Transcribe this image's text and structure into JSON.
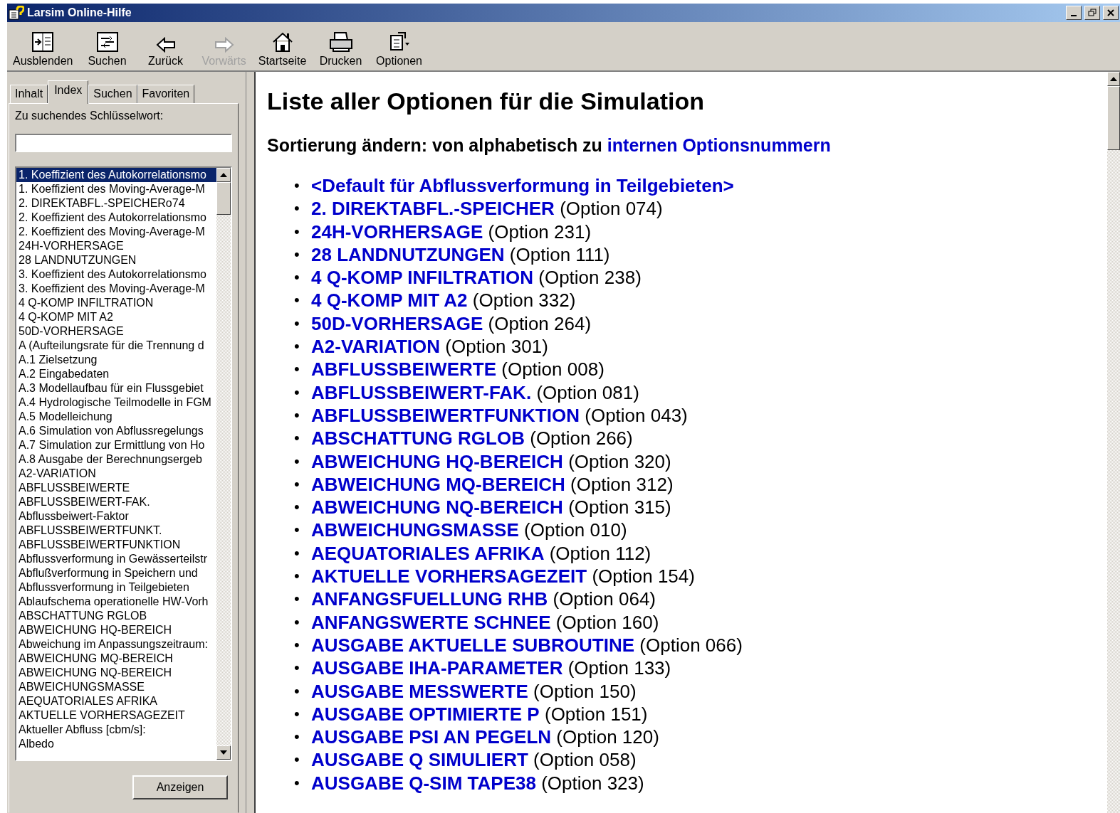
{
  "window": {
    "title": "Larsim Online-Hilfe"
  },
  "toolbar": [
    {
      "label": "Ausblenden",
      "disabled": false
    },
    {
      "label": "Suchen",
      "disabled": false
    },
    {
      "label": "Zurück",
      "disabled": false
    },
    {
      "label": "Vorwärts",
      "disabled": true
    },
    {
      "label": "Startseite",
      "disabled": false
    },
    {
      "label": "Drucken",
      "disabled": false
    },
    {
      "label": "Optionen",
      "disabled": false
    }
  ],
  "tabs": [
    {
      "label": "Inhalt",
      "selected": false
    },
    {
      "label": "Index",
      "selected": true
    },
    {
      "label": "Suchen",
      "selected": false
    },
    {
      "label": "Favoriten",
      "selected": false
    }
  ],
  "keyword": {
    "label": "Zu suchendes Schlüsselwort:"
  },
  "index_items": [
    {
      "label": "1. Koeffizient des Autokorrelationsmo",
      "selected": true
    },
    {
      "label": "1. Koeffizient des Moving-Average-M",
      "selected": false
    },
    {
      "label": "2. DIREKTABFL.-SPEICHERo74",
      "selected": false
    },
    {
      "label": "2. Koeffizient des Autokorrelationsmo",
      "selected": false
    },
    {
      "label": "2. Koeffizient des Moving-Average-M",
      "selected": false
    },
    {
      "label": "24H-VORHERSAGE",
      "selected": false
    },
    {
      "label": "28 LANDNUTZUNGEN",
      "selected": false
    },
    {
      "label": "3. Koeffizient des Autokorrelationsmo",
      "selected": false
    },
    {
      "label": "3. Koeffizient des Moving-Average-M",
      "selected": false
    },
    {
      "label": "4 Q-KOMP INFILTRATION",
      "selected": false
    },
    {
      "label": "4 Q-KOMP MIT A2",
      "selected": false
    },
    {
      "label": "50D-VORHERSAGE",
      "selected": false
    },
    {
      "label": "A (Aufteilungsrate für die Trennung d",
      "selected": false
    },
    {
      "label": "A.1 Zielsetzung",
      "selected": false
    },
    {
      "label": "A.2 Eingabedaten",
      "selected": false
    },
    {
      "label": "A.3 Modellaufbau für ein Flussgebiet",
      "selected": false
    },
    {
      "label": "A.4 Hydrologische Teilmodelle in FGM",
      "selected": false
    },
    {
      "label": "A.5 Modelleichung",
      "selected": false
    },
    {
      "label": "A.6 Simulation von Abflussregelungs",
      "selected": false
    },
    {
      "label": "A.7 Simulation zur Ermittlung von Ho",
      "selected": false
    },
    {
      "label": "A.8 Ausgabe der Berechnungsergeb",
      "selected": false
    },
    {
      "label": "A2-VARIATION",
      "selected": false
    },
    {
      "label": "ABFLUSSBEIWERTE",
      "selected": false
    },
    {
      "label": "ABFLUSSBEIWERT-FAK.",
      "selected": false
    },
    {
      "label": "Abflussbeiwert-Faktor",
      "selected": false
    },
    {
      "label": "ABFLUSSBEIWERTFUNKT.",
      "selected": false
    },
    {
      "label": "ABFLUSSBEIWERTFUNKTION",
      "selected": false
    },
    {
      "label": "Abflussverformung in Gewässerteilstr",
      "selected": false
    },
    {
      "label": "Abflußverformung in Speichern und",
      "selected": false
    },
    {
      "label": "Abflussverformung in Teilgebieten",
      "selected": false
    },
    {
      "label": "Ablaufschema operationelle HW-Vorh",
      "selected": false
    },
    {
      "label": "ABSCHATTUNG RGLOB",
      "selected": false
    },
    {
      "label": "ABWEICHUNG HQ-BEREICH",
      "selected": false
    },
    {
      "label": "Abweichung im Anpassungszeitraum:",
      "selected": false
    },
    {
      "label": "ABWEICHUNG MQ-BEREICH",
      "selected": false
    },
    {
      "label": "ABWEICHUNG NQ-BEREICH",
      "selected": false
    },
    {
      "label": "ABWEICHUNGSMASSE",
      "selected": false
    },
    {
      "label": "AEQUATORIALES AFRIKA",
      "selected": false
    },
    {
      "label": "AKTUELLE VORHERSAGEZEIT",
      "selected": false
    },
    {
      "label": "Aktueller Abfluss [cbm/s]:",
      "selected": false
    },
    {
      "label": "Albedo",
      "selected": false
    }
  ],
  "show_button": "Anzeigen",
  "content": {
    "heading": "Liste aller Optionen für die Simulation",
    "sort_text": "Sortierung ändern: von alphabetisch zu",
    "sort_link": "internen Optionsnummern",
    "options": [
      {
        "bullet": "•",
        "name": "<Default für Abflussverformung in Teilgebieten>"
      },
      {
        "bullet": "•",
        "name": "2. DIREKTABFL.-SPEICHER",
        "number": "(Option 074)"
      },
      {
        "bullet": "•",
        "name": "24H-VORHERSAGE",
        "number": "(Option 231)"
      },
      {
        "bullet": "•",
        "name": "28 LANDNUTZUNGEN",
        "number": "(Option 111)"
      },
      {
        "bullet": "•",
        "name": "4 Q-KOMP INFILTRATION",
        "number": "(Option 238)"
      },
      {
        "bullet": "•",
        "name": "4 Q-KOMP MIT A2",
        "number": "(Option 332)"
      },
      {
        "bullet": "•",
        "name": "50D-VORHERSAGE",
        "number": "(Option 264)"
      },
      {
        "bullet": "•",
        "name": "A2-VARIATION",
        "number": "(Option 301)"
      },
      {
        "bullet": "•",
        "name": "ABFLUSSBEIWERTE",
        "number": "(Option 008)"
      },
      {
        "bullet": "•",
        "name": "ABFLUSSBEIWERT-FAK.",
        "number": "(Option 081)"
      },
      {
        "bullet": "•",
        "name": "ABFLUSSBEIWERTFUNKTION",
        "number": "(Option 043)"
      },
      {
        "bullet": "•",
        "name": "ABSCHATTUNG RGLOB",
        "number": "(Option 266)"
      },
      {
        "bullet": "•",
        "name": "ABWEICHUNG HQ-BEREICH",
        "number": "(Option 320)"
      },
      {
        "bullet": "•",
        "name": "ABWEICHUNG MQ-BEREICH",
        "number": "(Option 312)"
      },
      {
        "bullet": "•",
        "name": "ABWEICHUNG NQ-BEREICH",
        "number": "(Option 315)"
      },
      {
        "bullet": "•",
        "name": "ABWEICHUNGSMASSE",
        "number": "(Option 010)"
      },
      {
        "bullet": "•",
        "name": "AEQUATORIALES AFRIKA",
        "number": "(Option 112)"
      },
      {
        "bullet": "•",
        "name": "AKTUELLE VORHERSAGEZEIT",
        "number": "(Option 154)"
      },
      {
        "bullet": "•",
        "name": "ANFANGSFUELLUNG RHB",
        "number": "(Option 064)"
      },
      {
        "bullet": "•",
        "name": "ANFANGSWERTE SCHNEE",
        "number": "(Option 160)"
      },
      {
        "bullet": "•",
        "name": "AUSGABE AKTUELLE SUBROUTINE",
        "number": "(Option 066)"
      },
      {
        "bullet": "•",
        "name": "AUSGABE IHA-PARAMETER",
        "number": "(Option 133)"
      },
      {
        "bullet": "•",
        "name": "AUSGABE MESSWERTE",
        "number": "(Option 150)"
      },
      {
        "bullet": "•",
        "name": "AUSGABE OPTIMIERTE P",
        "number": "(Option 151)"
      },
      {
        "bullet": "•",
        "name": "AUSGABE PSI AN PEGELN",
        "number": "(Option 120)"
      },
      {
        "bullet": "•",
        "name": "AUSGABE Q SIMULIERT",
        "number": "(Option 058)"
      },
      {
        "bullet": "•",
        "name": "AUSGABE Q-SIM TAPE38",
        "number": "(Option 323)"
      }
    ]
  }
}
